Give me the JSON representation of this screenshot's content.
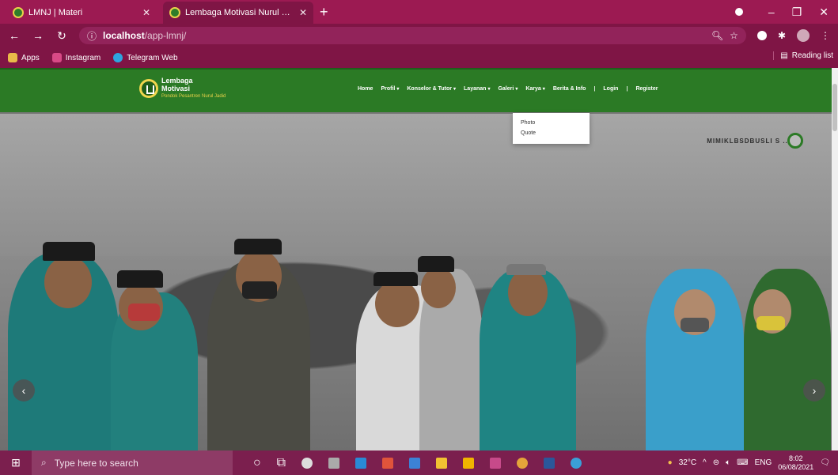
{
  "browser": {
    "tabs": [
      {
        "title": "LMNJ | Materi",
        "active": false
      },
      {
        "title": "Lembaga Motivasi Nurul Jadid -",
        "active": true
      }
    ],
    "new_tab": "+",
    "url_host": "localhost",
    "url_path": "/app-lmnj/",
    "bookmarks": [
      "Apps",
      "Instagram",
      "Telegram Web"
    ],
    "reading_list": "Reading list"
  },
  "site": {
    "logo": {
      "line1": "Lembaga",
      "line2": "Motivasi",
      "tagline": "Pondok Pesantren Nurul Jadid"
    },
    "menu": [
      {
        "label": "Home",
        "has_caret": false
      },
      {
        "label": "Profil",
        "has_caret": true
      },
      {
        "label": "Konselor & Tutor",
        "has_caret": true
      },
      {
        "label": "Layanan",
        "has_caret": true
      },
      {
        "label": "Galeri",
        "has_caret": true
      },
      {
        "label": "Karya",
        "has_caret": true
      },
      {
        "label": "Berita & Info",
        "has_caret": false
      },
      {
        "label": "Login",
        "has_caret": false
      },
      {
        "label": "Register",
        "has_caret": false
      }
    ],
    "dropdown": [
      "Photo",
      "Quote"
    ],
    "banner_text": "MIMIKLBSDBUSLI S ..."
  },
  "carousel": {
    "prev": "‹",
    "next": "›"
  },
  "taskbar": {
    "search_placeholder": "Type here to search",
    "weather": "32°C",
    "lang": "ENG",
    "time": "8:02",
    "date": "06/08/2021"
  },
  "colors": {
    "nav_green": "#2b7a25",
    "chrome_magenta": "#7f1545"
  }
}
